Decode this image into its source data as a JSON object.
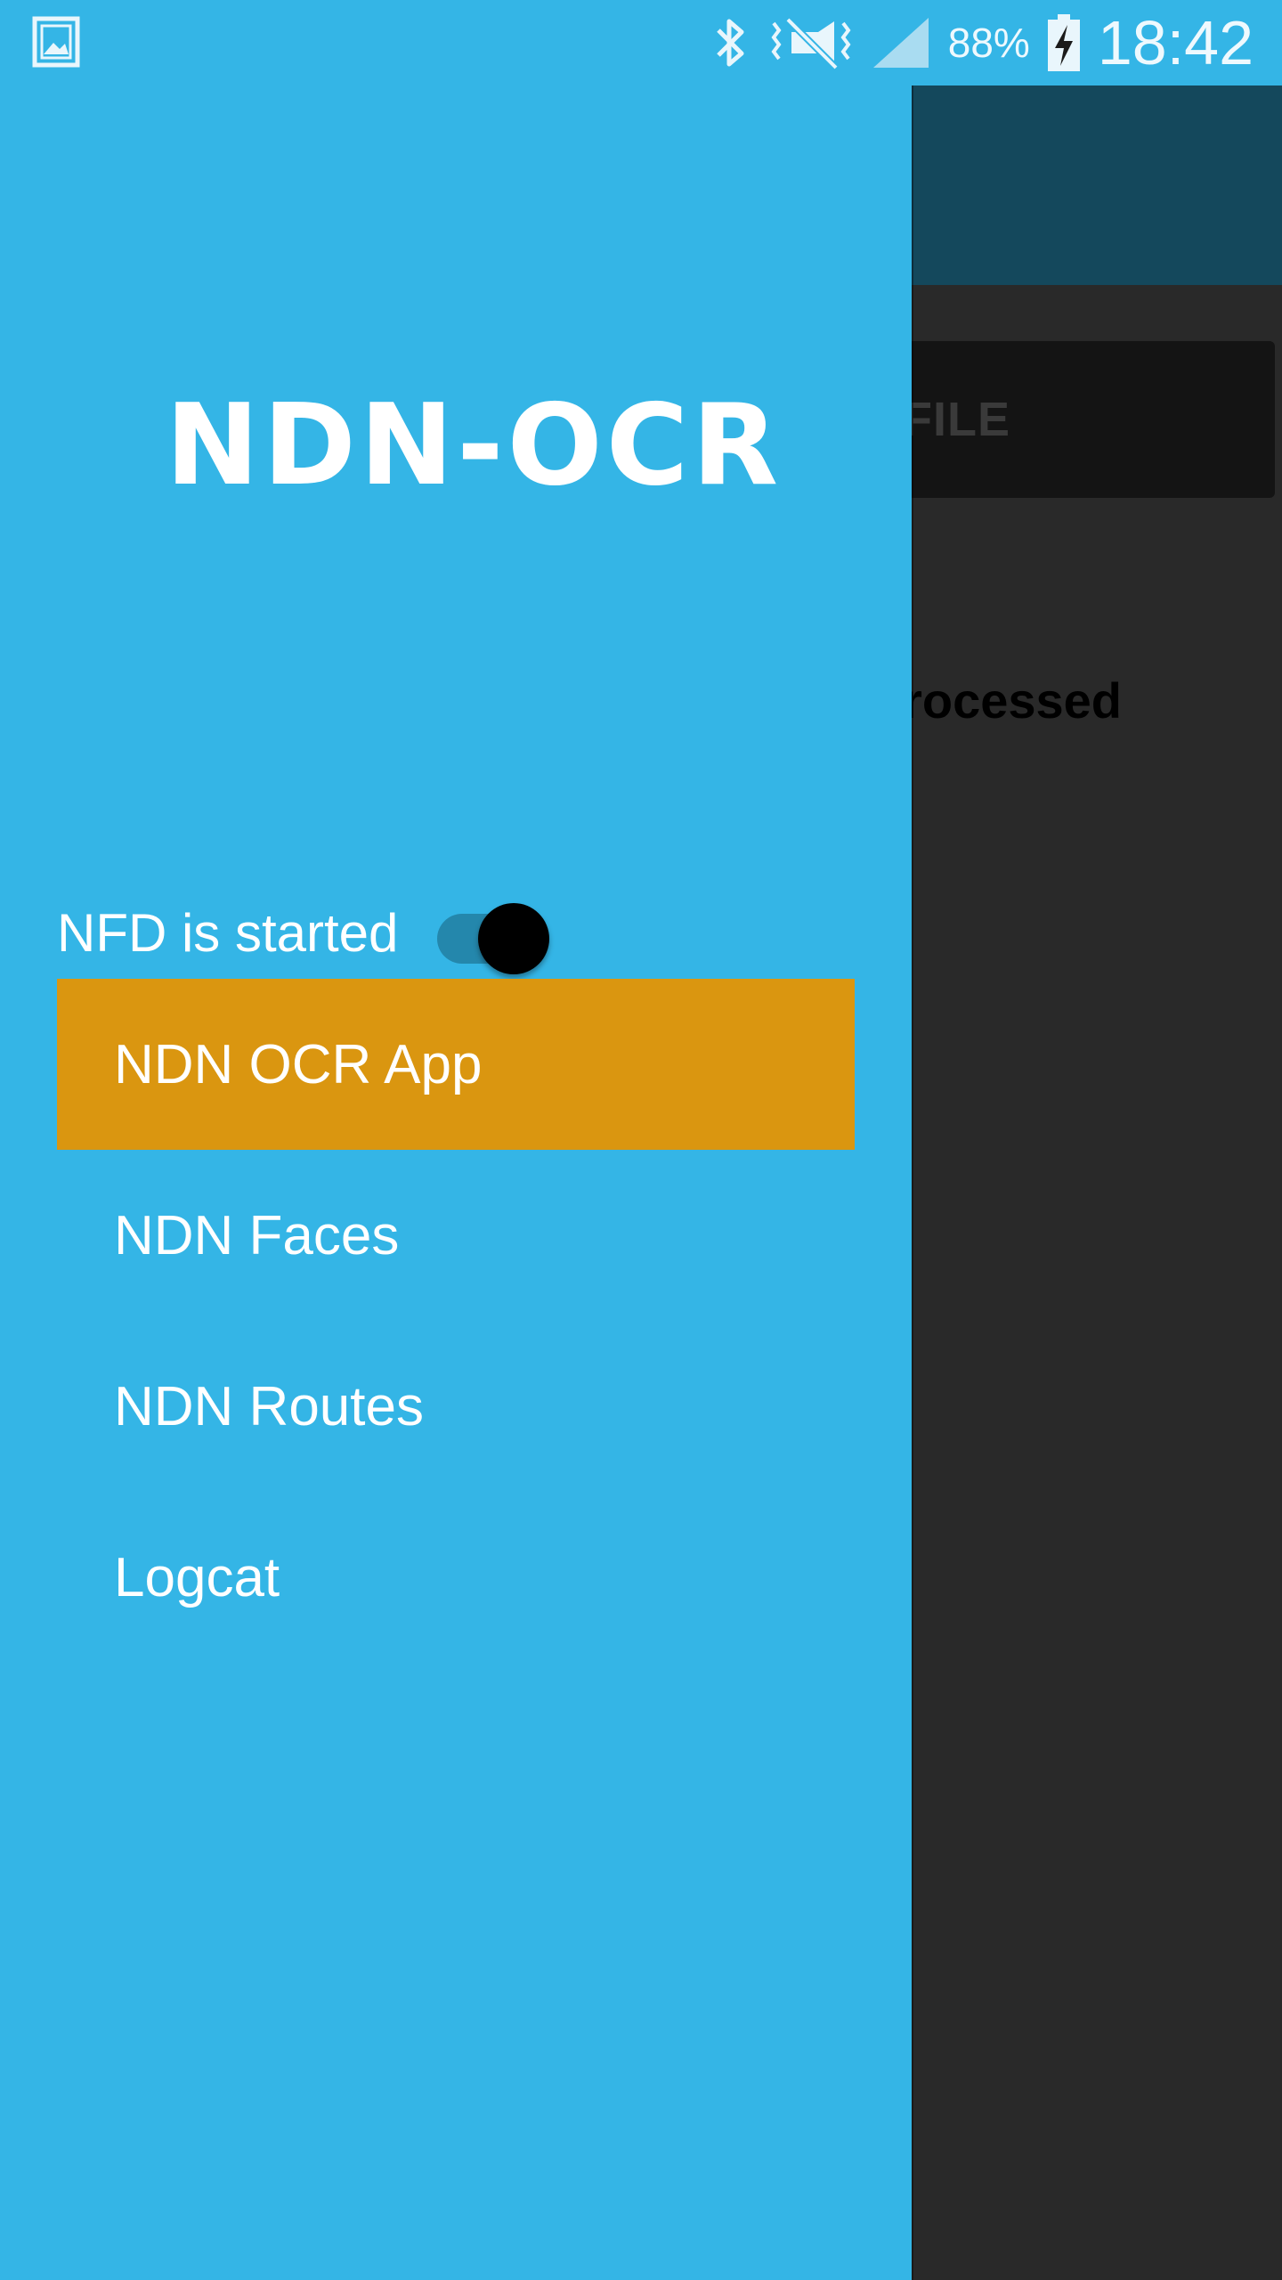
{
  "status_bar": {
    "icons": [
      "gallery-icon",
      "bluetooth-icon",
      "vibrate-icon",
      "signal-icon",
      "battery-charging-icon"
    ],
    "battery_percent": "88%",
    "time": "18:42"
  },
  "drawer": {
    "logo_text": "NDN-OCR",
    "nfd_toggle": {
      "label": "NFD is started",
      "on": true
    },
    "menu_items": [
      {
        "label": "NDN OCR App",
        "selected": true
      },
      {
        "label": "NDN Faces",
        "selected": false
      },
      {
        "label": "NDN Routes",
        "selected": false
      },
      {
        "label": "Logcat",
        "selected": false
      }
    ]
  },
  "background_app": {
    "button_partial_label": "FILE",
    "status_partial_text": "rocessed"
  },
  "colors": {
    "drawer_bg": "#34b5e6",
    "selected_item": "#da9610",
    "toolbar": "#14485c",
    "content_bg": "#292929"
  }
}
